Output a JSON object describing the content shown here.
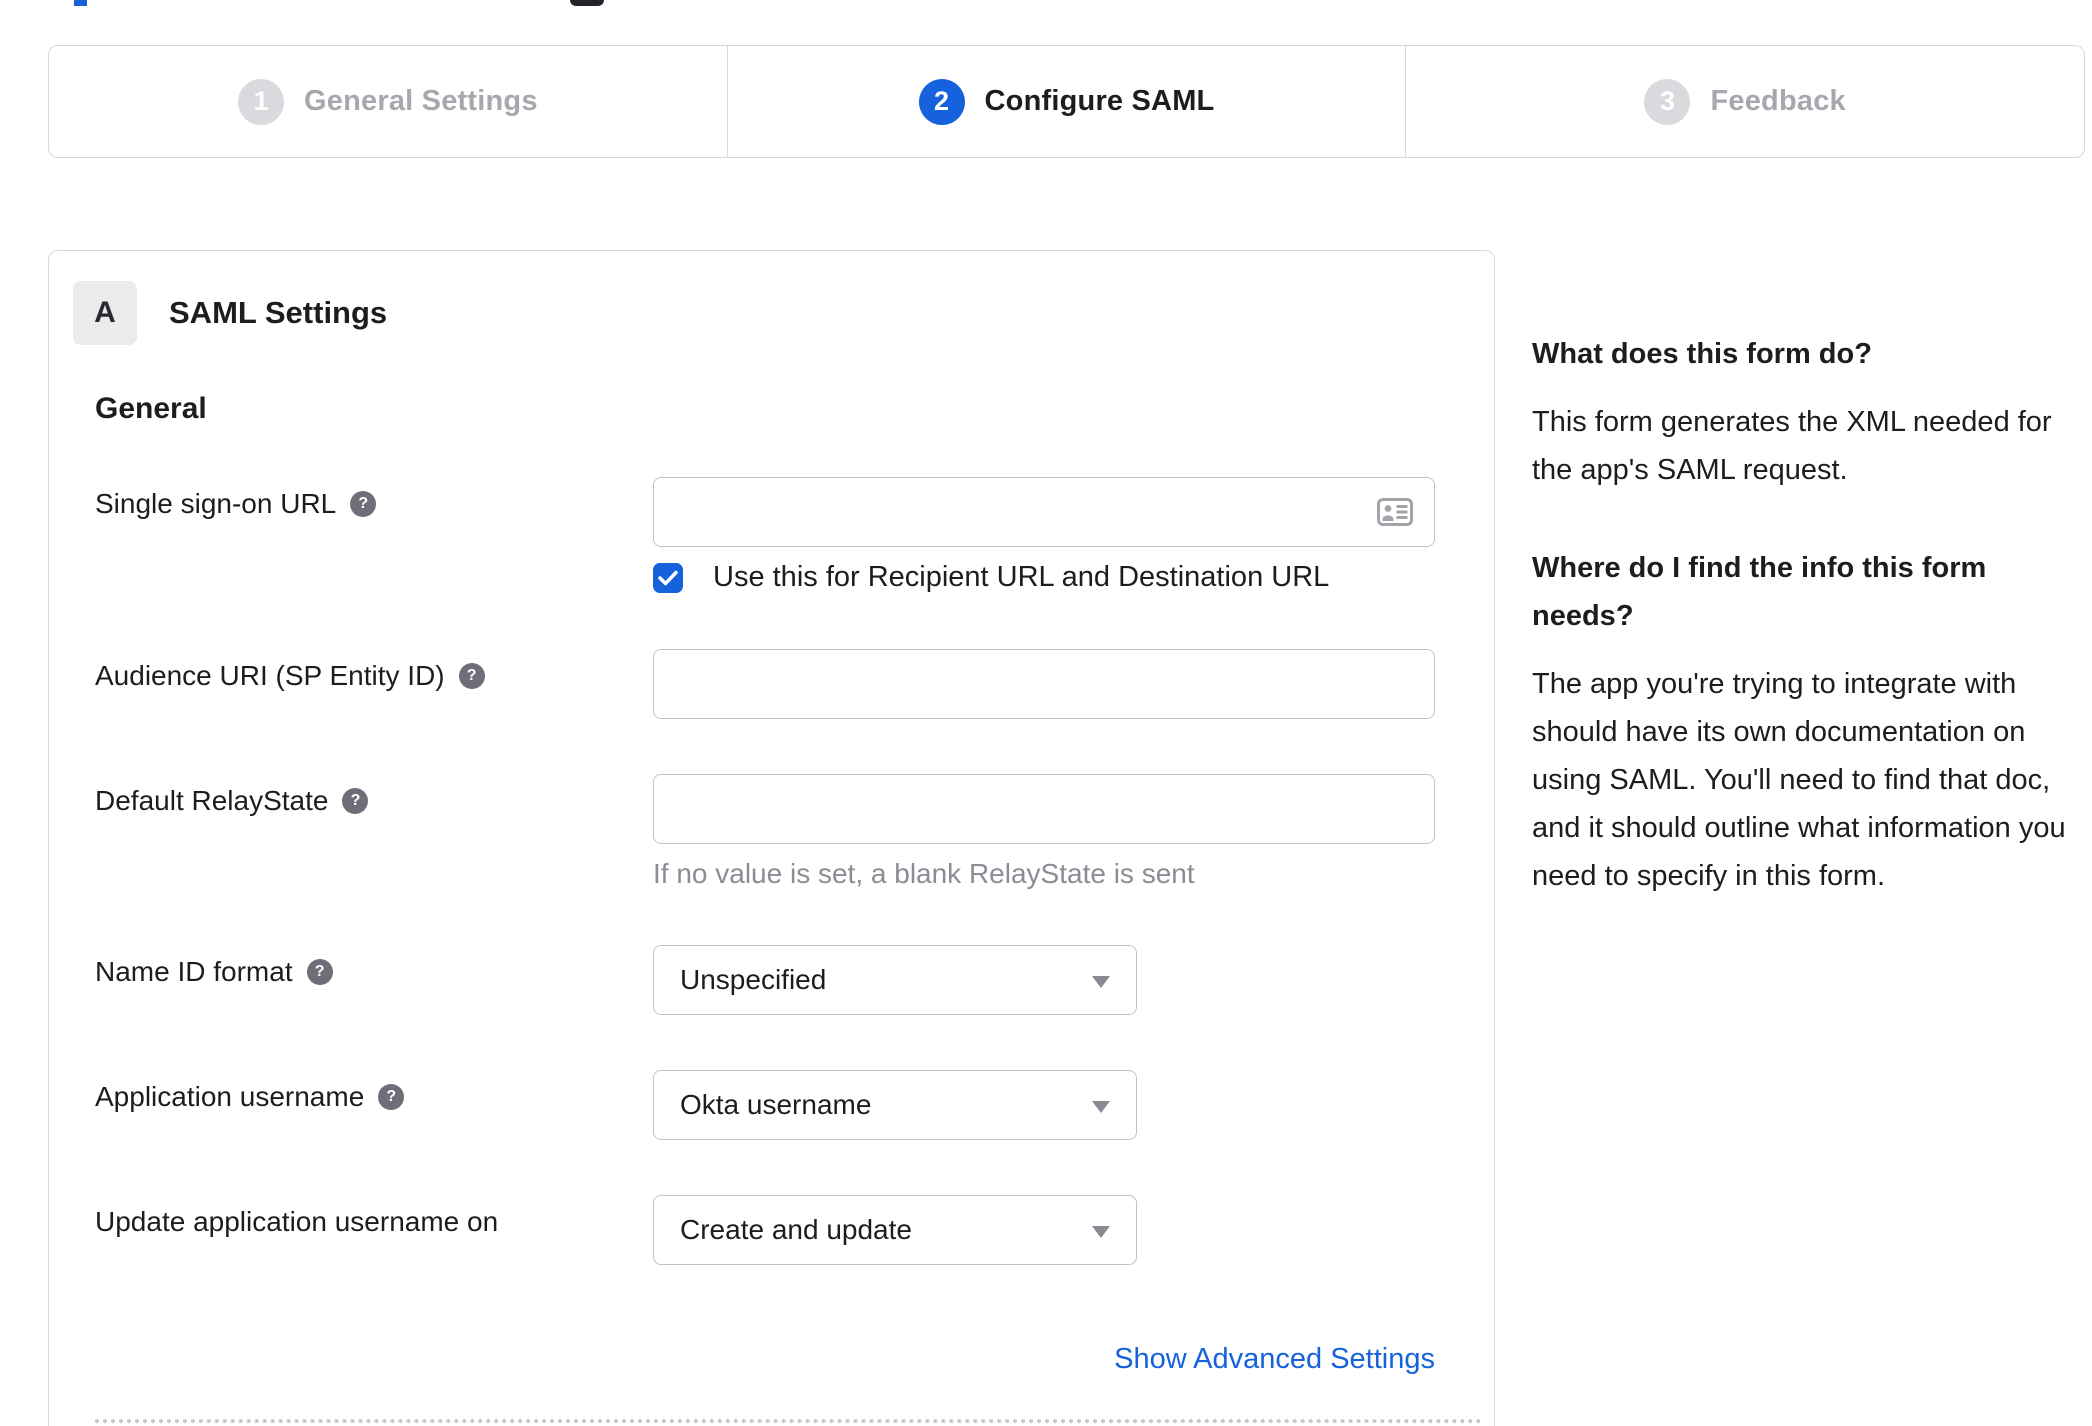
{
  "stepper": {
    "steps": [
      {
        "number": "1",
        "label": "General Settings",
        "state": "inactive"
      },
      {
        "number": "2",
        "label": "Configure SAML",
        "state": "active"
      },
      {
        "number": "3",
        "label": "Feedback",
        "state": "inactive"
      }
    ]
  },
  "panel": {
    "badge": "A",
    "title": "SAML Settings",
    "section": "General",
    "advanced_link": "Show Advanced Settings"
  },
  "form": {
    "sso": {
      "label": "Single sign-on URL",
      "value": "",
      "checkbox_label": "Use this for Recipient URL and Destination URL",
      "checked": true
    },
    "audience": {
      "label": "Audience URI (SP Entity ID)",
      "value": ""
    },
    "relay": {
      "label": "Default RelayState",
      "value": "",
      "helper": "If no value is set, a blank RelayState is sent"
    },
    "nameid": {
      "label": "Name ID format",
      "value": "Unspecified"
    },
    "appuser": {
      "label": "Application username",
      "value": "Okta username"
    },
    "update": {
      "label": "Update application username on",
      "value": "Create and update"
    }
  },
  "sidebar": {
    "q1_title": "What does this form do?",
    "q1_body": "This form generates the XML needed for the app's SAML request.",
    "q2_title": "Where do I find the info this form needs?",
    "q2_body": "The app you're trying to integrate with should have its own documentation on using SAML. You'll need to find that doc, and it should outline what information you need to specify in this form."
  },
  "icons": {
    "help_glyph": "?"
  },
  "colors": {
    "accent_blue": "#1662dd",
    "text_dark": "#1d1d21",
    "muted_gray": "#8c8c96",
    "border_gray": "#d8d8dc",
    "inactive_step_gray": "#a7a7ae"
  }
}
